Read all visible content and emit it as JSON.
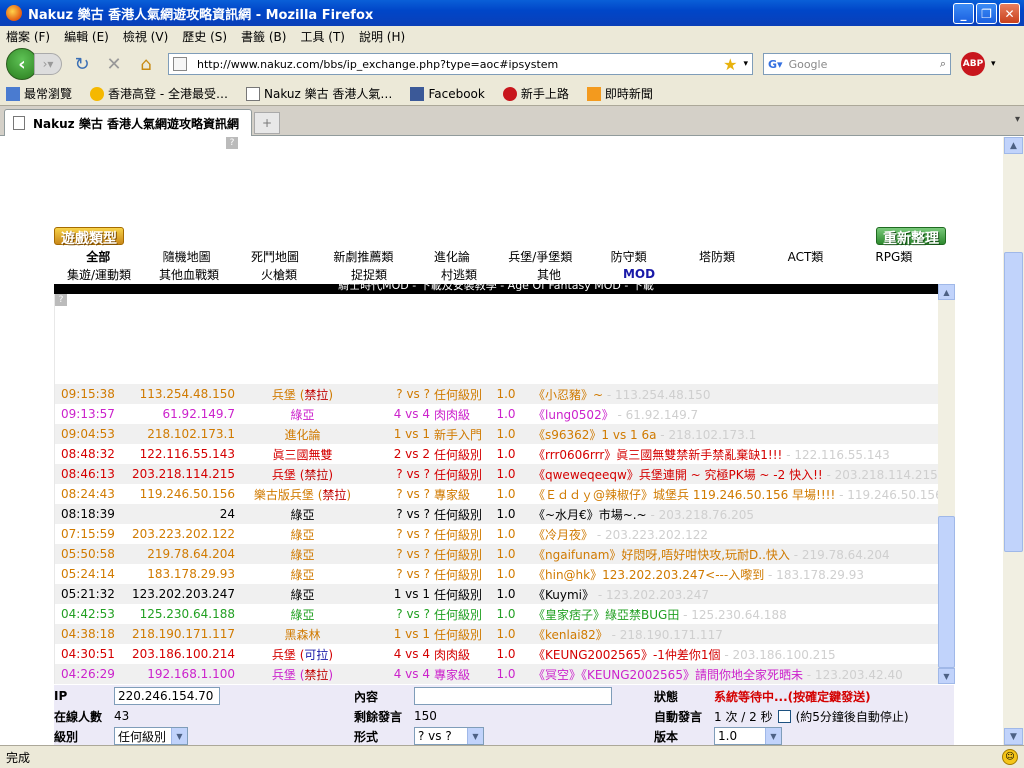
{
  "window": {
    "title": "Nakuz 樂古 香港人氣網遊攻略資訊網 - Mozilla Firefox"
  },
  "menu": [
    "檔案 (F)",
    "編輯 (E)",
    "檢視 (V)",
    "歷史 (S)",
    "書籤 (B)",
    "工具 (T)",
    "說明 (H)"
  ],
  "nav": {
    "url": "http://www.nakuz.com/bbs/ip_exchange.php?type=aoc#ipsystem",
    "search_placeholder": "Google"
  },
  "abp_label": "ABP",
  "bookmarks": [
    "最常瀏覽",
    "香港高登 - 全港最受…",
    "Nakuz 樂古 香港人氣…",
    "Facebook",
    "新手上路",
    "即時新聞"
  ],
  "tab": {
    "title": "Nakuz 樂古 香港人氣網遊攻略資訊網"
  },
  "status": "完成",
  "page": {
    "game_type_title": "遊戲類型",
    "refresh_title": "重新整理",
    "categories_row1": [
      "全部",
      "隨機地圖",
      "死鬥地圖",
      "新劇推薦類",
      "進化論",
      "兵堡/爭堡類",
      "防守類",
      "塔防類",
      "ACT類",
      "RPG類"
    ],
    "categories_row2": [
      "集遊/運動類",
      "其他血戰類",
      "火槍類",
      "捉捉類",
      "村逃類",
      "其他",
      "MOD"
    ],
    "marquee": "騎士時代MOD - 下載及安裝教學 - Age Of Fantasy MOD - 下載",
    "qmark": "?"
  },
  "rows": [
    {
      "time": "09:15:38",
      "ip": "113.254.48.150",
      "type": "兵堡",
      "paren": "禁拉",
      "vs": "? vs ?",
      "lvl": "任何級別",
      "ver": "1.0",
      "msg": "《小忍豬》~",
      "trail": " - 113.254.48.150",
      "color": "#d07a00"
    },
    {
      "time": "09:13:57",
      "ip": "61.92.149.7",
      "type": "綠亞",
      "paren": "",
      "vs": "4 vs 4",
      "lvl": "肉肉級",
      "ver": "1.0",
      "msg": "《lung0502》",
      "trail": " - 61.92.149.7",
      "color": "#cc22cc"
    },
    {
      "time": "09:04:53",
      "ip": "218.102.173.1",
      "type": "進化論",
      "paren": "",
      "vs": "1 vs 1",
      "lvl": "新手入門",
      "ver": "1.0",
      "msg": "《s96362》1 vs 1 6a",
      "trail": " - 218.102.173.1",
      "color": "#d07a00"
    },
    {
      "time": "08:48:32",
      "ip": "122.116.55.143",
      "type": "眞三國無雙",
      "paren": "",
      "vs": "2 vs 2",
      "lvl": "任何級別",
      "ver": "1.0",
      "msg": "《rrr0606rrr》眞三國無雙禁新手禁亂棄缺1!!!",
      "trail": " - 122.116.55.143",
      "color": "#d40000"
    },
    {
      "time": "08:46:13",
      "ip": "203.218.114.215",
      "type": "兵堡",
      "paren": "禁拉",
      "vs": "? vs ?",
      "lvl": "任何級別",
      "ver": "1.0",
      "msg": "《qweweqeeqw》兵堡連開 ~ 究極PK場 ~ -2 快入!!",
      "trail": " - 203.218.114.215",
      "color": "#d40000"
    },
    {
      "time": "08:24:43",
      "ip": "119.246.50.156",
      "type": "樂古版兵堡",
      "paren": "禁拉",
      "vs": "? vs ?",
      "lvl": "專家級",
      "ver": "1.0",
      "msg": "《Ｅｄｄｙ@辣椒仔》城堡兵 119.246.50.156 早場!!!!",
      "trail": " - 119.246.50.156",
      "color": "#d07a00"
    },
    {
      "time": "08:18:39",
      "ip": "24",
      "type": "綠亞",
      "paren": "",
      "vs": "? vs ?",
      "lvl": "任何級別",
      "ver": "1.0",
      "msg": "《~水月€》市場~.~",
      "trail": " - 203.218.76.205",
      "color": "#000000"
    },
    {
      "time": "07:15:59",
      "ip": "203.223.202.122",
      "type": "綠亞",
      "paren": "",
      "vs": "? vs ?",
      "lvl": "任何級別",
      "ver": "1.0",
      "msg": "《冷月夜》",
      "trail": " - 203.223.202.122",
      "color": "#d07a00"
    },
    {
      "time": "05:50:58",
      "ip": "219.78.64.204",
      "type": "綠亞",
      "paren": "",
      "vs": "? vs ?",
      "lvl": "任何級別",
      "ver": "1.0",
      "msg": "《ngaifunam》好悶呀,唔好咁快攻,玩耐D..快入",
      "trail": " - 219.78.64.204",
      "color": "#d07a00"
    },
    {
      "time": "05:24:14",
      "ip": "183.178.29.93",
      "type": "綠亞",
      "paren": "",
      "vs": "? vs ?",
      "lvl": "任何級別",
      "ver": "1.0",
      "msg": "《hin@hk》123.202.203.247<---入嚟到",
      "trail": " - 183.178.29.93",
      "color": "#d07a00"
    },
    {
      "time": "05:21:32",
      "ip": "123.202.203.247",
      "type": "綠亞",
      "paren": "",
      "vs": "1 vs 1",
      "lvl": "任何級別",
      "ver": "1.0",
      "msg": "《Kuymi》",
      "trail": " - 123.202.203.247",
      "color": "#000000"
    },
    {
      "time": "04:42:53",
      "ip": "125.230.64.188",
      "type": "綠亞",
      "paren": "",
      "vs": "? vs ?",
      "lvl": "任何級別",
      "ver": "1.0",
      "msg": "《皇家痞子》綠亞禁BUG田",
      "trail": " - 125.230.64.188",
      "color": "#22a022"
    },
    {
      "time": "04:38:18",
      "ip": "218.190.171.117",
      "type": "黑森林",
      "paren": "",
      "vs": "1 vs 1",
      "lvl": "任何級別",
      "ver": "1.0",
      "msg": "《kenlai82》",
      "trail": " - 218.190.171.117",
      "color": "#d07a00"
    },
    {
      "time": "04:30:51",
      "ip": "203.186.100.214",
      "type": "兵堡",
      "paren": "可拉",
      "vs": "4 vs 4",
      "lvl": "肉肉級",
      "ver": "1.0",
      "msg": "《KEUNG2002565》-1仲差你1個",
      "trail": " - 203.186.100.215",
      "color": "#d40000"
    },
    {
      "time": "04:26:29",
      "ip": "192.168.1.100",
      "type": "兵堡",
      "paren": "禁拉",
      "vs": "4 vs 4",
      "lvl": "專家級",
      "ver": "1.0",
      "msg": "《冥空》《KEUNG2002565》請問你地全家死晒未",
      "trail": " - 123.203.42.40",
      "color": "#cc22cc"
    }
  ],
  "form": {
    "ip_label": "IP",
    "ip_value": "220.246.154.70",
    "content_label": "內容",
    "content_value": "",
    "status_label": "狀態",
    "status_value": "系統等待中...(按確定鍵發送)",
    "online_label": "在線人數",
    "online_value": "43",
    "remaining_label": "剩餘發言",
    "remaining_value": "150",
    "auto_label": "自動發言",
    "auto_value": "1 次 / 2 秒",
    "auto_note": "(約5分鐘後自動停止)",
    "level_label": "級別",
    "level_value": "任何級別",
    "format_label": "形式",
    "format_value": "? vs ?",
    "version_label": "版本",
    "version_value": "1.0"
  }
}
